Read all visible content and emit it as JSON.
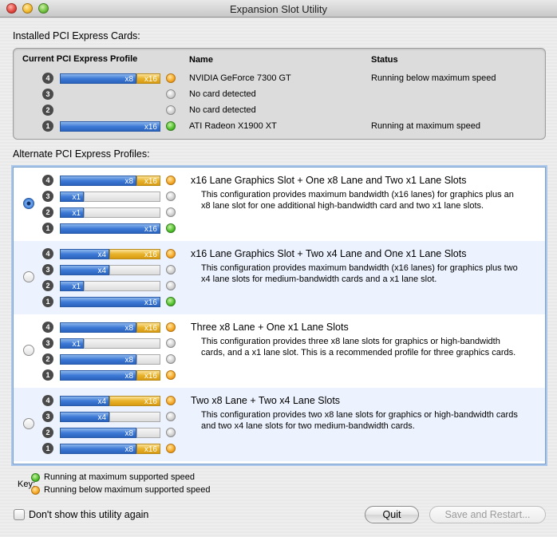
{
  "window": {
    "title": "Expansion Slot Utility"
  },
  "installed": {
    "label": "Installed PCI Express Cards:",
    "headers": {
      "profile": "Current PCI Express Profile",
      "name": "Name",
      "status": "Status"
    },
    "slots": [
      {
        "num": "4",
        "segs": [
          [
            "blue",
            "x8",
            96
          ],
          [
            "gold",
            "x16",
            30
          ]
        ],
        "dot": "orange",
        "name": "NVIDIA GeForce 7300 GT",
        "status": "Running below maximum speed"
      },
      {
        "num": "3",
        "segs": [],
        "dot": "grey",
        "name": "No card detected",
        "status": ""
      },
      {
        "num": "2",
        "segs": [],
        "dot": "grey",
        "name": "No card detected",
        "status": ""
      },
      {
        "num": "1",
        "segs": [
          [
            "blue",
            "x16",
            126
          ]
        ],
        "dot": "green",
        "name": "ATI Radeon X1900 XT",
        "status": "Running at maximum speed"
      }
    ]
  },
  "alternate": {
    "label": "Alternate PCI Express Profiles:",
    "profiles": [
      {
        "selected": true,
        "title": "x16 Lane Graphics Slot + One x8 Lane and Two x1 Lane Slots",
        "description": "This configuration provides maximum bandwidth (x16 lanes) for graphics plus an x8 lane slot for one additional high-bandwidth card and two x1 lane slots.",
        "slots": [
          {
            "num": "4",
            "segs": [
              [
                "blue",
                "x8",
                96
              ],
              [
                "gold",
                "x16",
                30
              ]
            ],
            "dot": "orange"
          },
          {
            "num": "3",
            "segs": [
              [
                "blue",
                "x1",
                30
              ],
              [
                "grey",
                "",
                96
              ]
            ],
            "dot": "grey"
          },
          {
            "num": "2",
            "segs": [
              [
                "blue",
                "x1",
                30
              ],
              [
                "grey",
                "",
                96
              ]
            ],
            "dot": "grey"
          },
          {
            "num": "1",
            "segs": [
              [
                "blue",
                "x16",
                126
              ]
            ],
            "dot": "green"
          }
        ]
      },
      {
        "selected": false,
        "title": "x16 Lane Graphics Slot + Two x4 Lane and One x1 Lane Slots",
        "description": "This configuration provides maximum bandwidth (x16 lanes) for graphics plus two x4 lane slots for medium-bandwidth cards and a x1 lane slot.",
        "slots": [
          {
            "num": "4",
            "segs": [
              [
                "blue",
                "x4",
                62
              ],
              [
                "gold",
                "x16",
                64
              ]
            ],
            "dot": "orange"
          },
          {
            "num": "3",
            "segs": [
              [
                "blue",
                "x4",
                62
              ],
              [
                "grey",
                "",
                64
              ]
            ],
            "dot": "grey"
          },
          {
            "num": "2",
            "segs": [
              [
                "blue",
                "x1",
                30
              ],
              [
                "grey",
                "",
                96
              ]
            ],
            "dot": "grey"
          },
          {
            "num": "1",
            "segs": [
              [
                "blue",
                "x16",
                126
              ]
            ],
            "dot": "green"
          }
        ]
      },
      {
        "selected": false,
        "title": "Three x8 Lane + One x1 Lane Slots",
        "description": "This configuration provides three x8 lane slots for graphics or high-bandwidth cards, and a x1 lane slot.  This is a recommended profile for three graphics cards.",
        "slots": [
          {
            "num": "4",
            "segs": [
              [
                "blue",
                "x8",
                96
              ],
              [
                "gold",
                "x16",
                30
              ]
            ],
            "dot": "orange"
          },
          {
            "num": "3",
            "segs": [
              [
                "blue",
                "x1",
                30
              ],
              [
                "grey",
                "",
                96
              ]
            ],
            "dot": "grey"
          },
          {
            "num": "2",
            "segs": [
              [
                "blue",
                "x8",
                96
              ],
              [
                "grey",
                "",
                30
              ]
            ],
            "dot": "grey"
          },
          {
            "num": "1",
            "segs": [
              [
                "blue",
                "x8",
                96
              ],
              [
                "gold",
                "x16",
                30
              ]
            ],
            "dot": "orange"
          }
        ]
      },
      {
        "selected": false,
        "title": "Two x8 Lane + Two x4 Lane Slots",
        "description": "This configuration provides two x8 lane slots for graphics or high-bandwidth cards and two x4 lane slots for two medium-bandwidth cards.",
        "slots": [
          {
            "num": "4",
            "segs": [
              [
                "blue",
                "x4",
                62
              ],
              [
                "gold",
                "x16",
                64
              ]
            ],
            "dot": "orange"
          },
          {
            "num": "3",
            "segs": [
              [
                "blue",
                "x4",
                62
              ],
              [
                "grey",
                "",
                64
              ]
            ],
            "dot": "grey"
          },
          {
            "num": "2",
            "segs": [
              [
                "blue",
                "x8",
                96
              ],
              [
                "grey",
                "",
                30
              ]
            ],
            "dot": "grey"
          },
          {
            "num": "1",
            "segs": [
              [
                "blue",
                "x8",
                96
              ],
              [
                "gold",
                "x16",
                30
              ]
            ],
            "dot": "orange"
          }
        ]
      }
    ]
  },
  "key": {
    "label": "Key:",
    "items": [
      {
        "dot": "green",
        "text": "Running at maximum supported speed"
      },
      {
        "dot": "orange",
        "text": "Running below maximum supported speed"
      }
    ]
  },
  "footer": {
    "checkbox_label": "Don't show this utility again",
    "checkbox_checked": false,
    "quit_label": "Quit",
    "save_label": "Save and Restart..."
  }
}
